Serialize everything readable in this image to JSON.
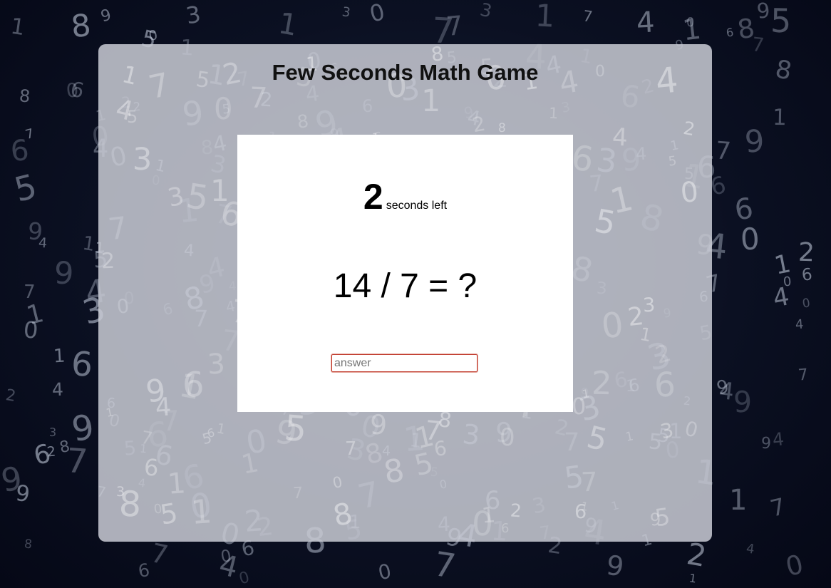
{
  "game": {
    "title": "Few Seconds Math Game",
    "timer": {
      "seconds": "2",
      "label": "seconds left"
    },
    "question": "14 / 7 = ?",
    "answer_input": {
      "placeholder": "answer",
      "value": ""
    }
  },
  "colors": {
    "background": "#0b1022",
    "panel": "#c8cbd4",
    "card": "#ffffff",
    "input_border": "#c0392b"
  }
}
